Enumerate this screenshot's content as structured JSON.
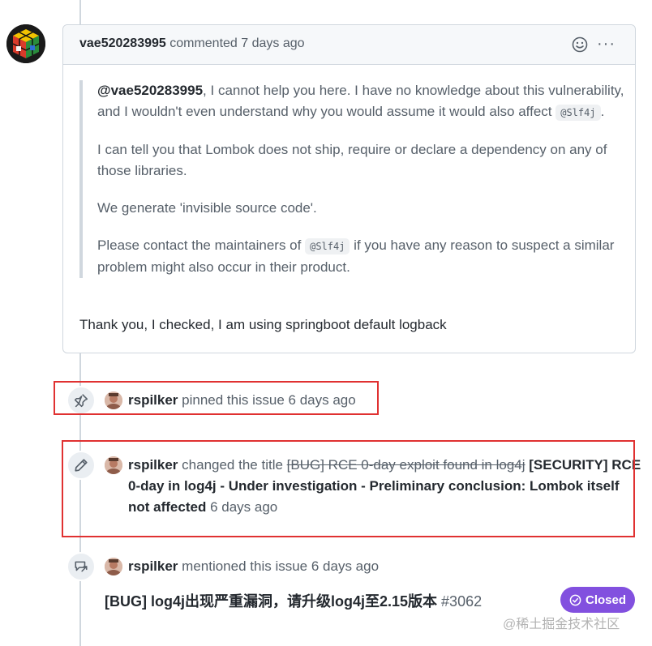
{
  "comment": {
    "author": "vae520283995",
    "action": " commented ",
    "time": "7 days ago",
    "quote": {
      "p1_mention": "@vae520283995",
      "p1_text": ", I cannot help you here. I have no knowledge about this vulnerability, and I wouldn't even understand why you would assume it would also affect ",
      "p1_code": "@Slf4j",
      "p1_end": ".",
      "p2": "I can tell you that Lombok does not ship, require or declare a dependency on any of those libraries.",
      "p3": "We generate 'invisible source code'.",
      "p4_start": "Please contact the maintainers of ",
      "p4_code": "@Slf4j",
      "p4_end": " if you have any reason to suspect a similar problem might also occur in their product."
    },
    "reply": "Thank you, I checked, I am using springboot default logback",
    "menu": "···"
  },
  "events": {
    "pin": {
      "author": "rspilker",
      "text": " pinned this issue ",
      "time": "6 days ago"
    },
    "rename": {
      "author": "rspilker",
      "text": " changed the title ",
      "old_title": "[BUG] RCE 0-day exploit found in log4j",
      "new_title": "[SECURITY] RCE 0-day in log4j - Under investigation - Preliminary conclusion: Lombok itself not affected",
      "time": "6 days ago"
    },
    "mention": {
      "author": "rspilker",
      "text": " mentioned this issue ",
      "time": "6 days ago",
      "ref_title": "[BUG] log4j出现严重漏洞，请升级log4j至2.15版本",
      "ref_number": "#3062",
      "status": "Closed"
    }
  },
  "watermark": "@稀土掘金技术社区",
  "colors": {
    "closed": "#8250df",
    "highlight": "#e03131"
  }
}
